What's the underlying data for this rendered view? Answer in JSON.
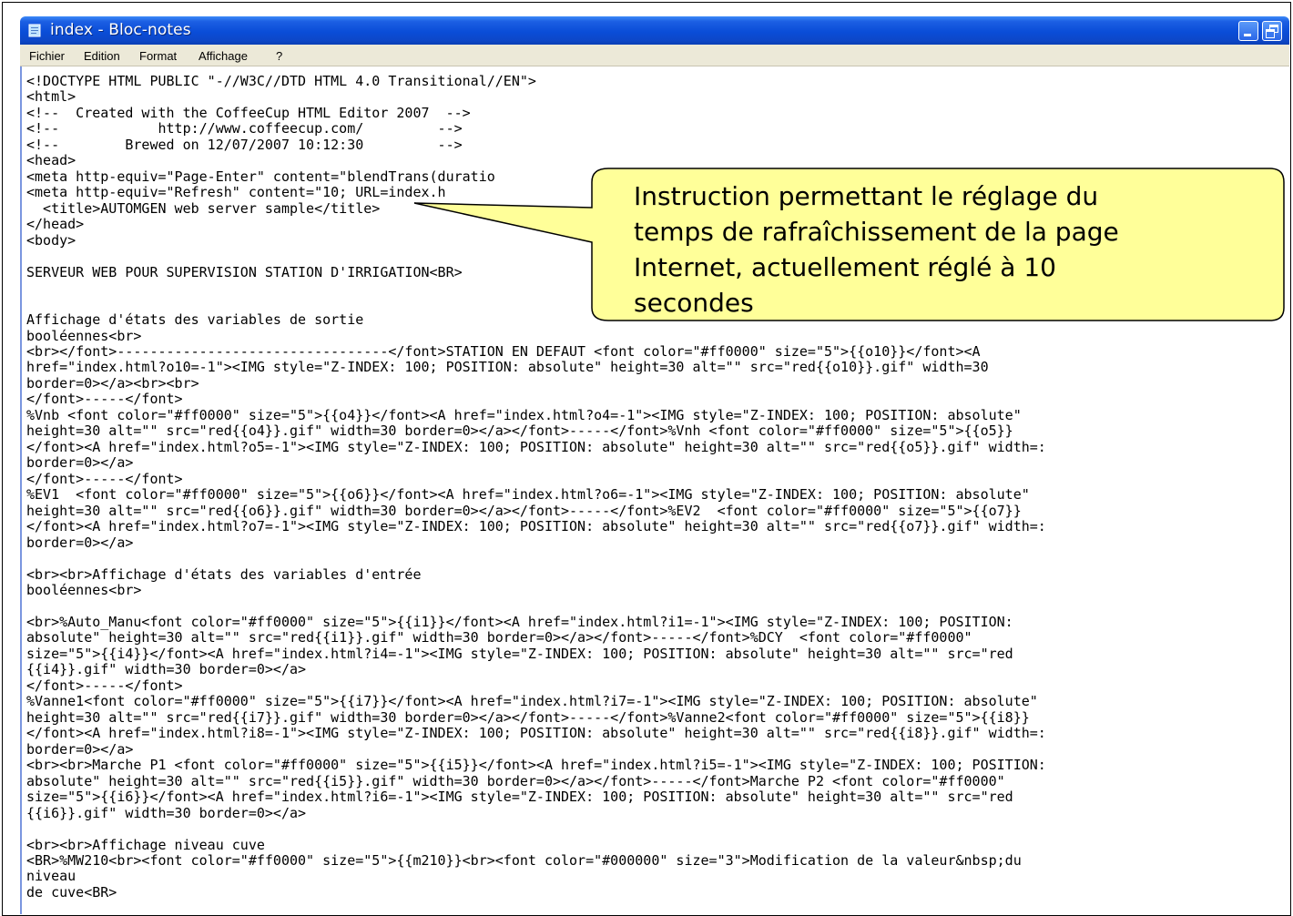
{
  "window": {
    "title": "index - Bloc-notes",
    "controls": [
      "minimize-icon",
      "restore-icon"
    ]
  },
  "menubar": {
    "items": [
      "Fichier",
      "Edition",
      "Format",
      "Affichage",
      "?"
    ]
  },
  "editor": {
    "content": "<!DOCTYPE HTML PUBLIC \"-//W3C//DTD HTML 4.0 Transitional//EN\">\n<html>\n<!--  Created with the CoffeeCup HTML Editor 2007  -->\n<!--            http://www.coffeecup.com/         -->\n<!--        Brewed on 12/07/2007 10:12:30         -->\n<head>\n<meta http-equiv=\"Page-Enter\" content=\"blendTrans(duratio\n<meta http-equiv=\"Refresh\" content=\"10; URL=index.h\n  <title>AUTOMGEN web server sample</title>\n</head>\n<body>\n\nSERVEUR WEB POUR SUPERVISION STATION D'IRRIGATION<BR>\n\n\nAffichage d'états des variables de sortie\nbooléennes<br>\n<br></font>---------------------------------</font>STATION EN DEFAUT <font color=\"#ff0000\" size=\"5\">{{o10}}</font><A\nhref=\"index.html?o10=-1\"><IMG style=\"Z-INDEX: 100; POSITION: absolute\" height=30 alt=\"\" src=\"red{{o10}}.gif\" width=30\nborder=0></a><br><br>\n</font>-----</font>\n%Vnb <font color=\"#ff0000\" size=\"5\">{{o4}}</font><A href=\"index.html?o4=-1\"><IMG style=\"Z-INDEX: 100; POSITION: absolute\"\nheight=30 alt=\"\" src=\"red{{o4}}.gif\" width=30 border=0></a></font>-----</font>%Vnh <font color=\"#ff0000\" size=\"5\">{{o5}}\n</font><A href=\"index.html?o5=-1\"><IMG style=\"Z-INDEX: 100; POSITION: absolute\" height=30 alt=\"\" src=\"red{{o5}}.gif\" width=:\nborder=0></a>\n</font>-----</font>\n%EV1  <font color=\"#ff0000\" size=\"5\">{{o6}}</font><A href=\"index.html?o6=-1\"><IMG style=\"Z-INDEX: 100; POSITION: absolute\"\nheight=30 alt=\"\" src=\"red{{o6}}.gif\" width=30 border=0></a></font>-----</font>%EV2  <font color=\"#ff0000\" size=\"5\">{{o7}}\n</font><A href=\"index.html?o7=-1\"><IMG style=\"Z-INDEX: 100; POSITION: absolute\" height=30 alt=\"\" src=\"red{{o7}}.gif\" width=:\nborder=0></a>\n\n<br><br>Affichage d'états des variables d'entrée\nbooléennes<br>\n\n<br>%Auto_Manu<font color=\"#ff0000\" size=\"5\">{{i1}}</font><A href=\"index.html?i1=-1\"><IMG style=\"Z-INDEX: 100; POSITION:\nabsolute\" height=30 alt=\"\" src=\"red{{i1}}.gif\" width=30 border=0></a></font>-----</font>%DCY  <font color=\"#ff0000\"\nsize=\"5\">{{i4}}</font><A href=\"index.html?i4=-1\"><IMG style=\"Z-INDEX: 100; POSITION: absolute\" height=30 alt=\"\" src=\"red\n{{i4}}.gif\" width=30 border=0></a>\n</font>-----</font>\n%Vanne1<font color=\"#ff0000\" size=\"5\">{{i7}}</font><A href=\"index.html?i7=-1\"><IMG style=\"Z-INDEX: 100; POSITION: absolute\"\nheight=30 alt=\"\" src=\"red{{i7}}.gif\" width=30 border=0></a></font>-----</font>%Vanne2<font color=\"#ff0000\" size=\"5\">{{i8}}\n</font><A href=\"index.html?i8=-1\"><IMG style=\"Z-INDEX: 100; POSITION: absolute\" height=30 alt=\"\" src=\"red{{i8}}.gif\" width=:\nborder=0></a>\n<br><br>Marche P1 <font color=\"#ff0000\" size=\"5\">{{i5}}</font><A href=\"index.html?i5=-1\"><IMG style=\"Z-INDEX: 100; POSITION:\nabsolute\" height=30 alt=\"\" src=\"red{{i5}}.gif\" width=30 border=0></a></font>-----</font>Marche P2 <font color=\"#ff0000\"\nsize=\"5\">{{i6}}</font><A href=\"index.html?i6=-1\"><IMG style=\"Z-INDEX: 100; POSITION: absolute\" height=30 alt=\"\" src=\"red\n{{i6}}.gif\" width=30 border=0></a>\n\n<br><br>Affichage niveau cuve\n<BR>%MW210<br><font color=\"#ff0000\" size=\"5\">{{m210}}<br><font color=\"#000000\" size=\"3\">Modification de la valeur&nbsp;du\nniveau\nde cuve<BR>"
  },
  "callout": {
    "text": "Instruction permettant le réglage du\ntemps de rafraîchissement de la page\nInternet, actuellement réglé à 10\nsecondes",
    "fill": "#ffff99",
    "stroke": "#000000"
  },
  "colors": {
    "titlebar": "#0a4dd8",
    "menubar": "#ece9d8",
    "editor_border": "#7a96df"
  }
}
